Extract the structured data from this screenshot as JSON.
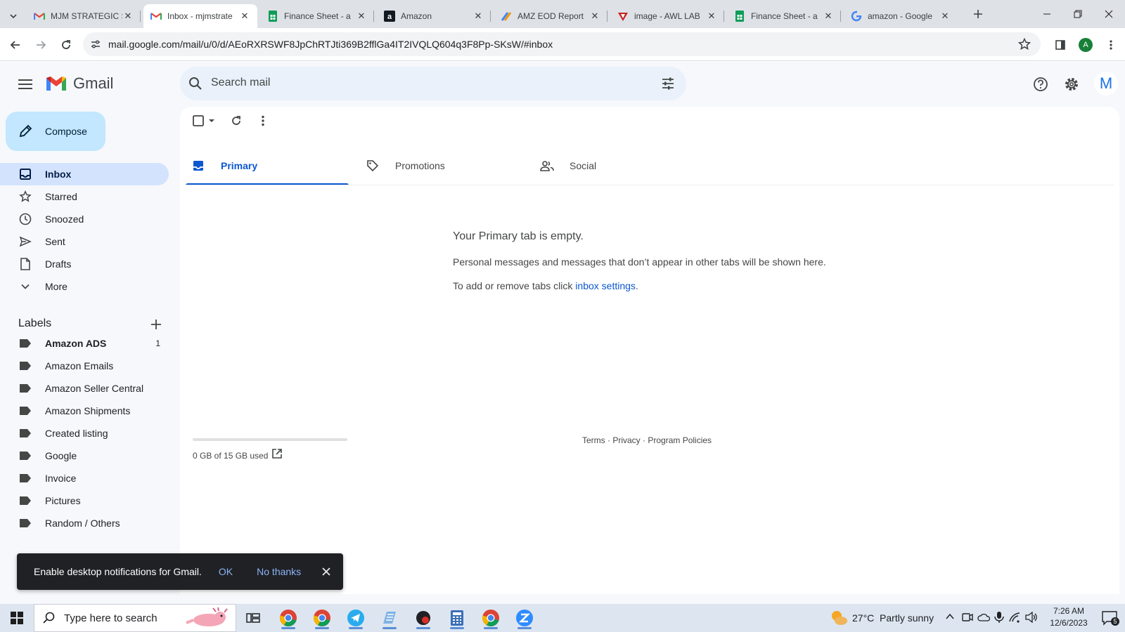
{
  "browser": {
    "tabs": [
      {
        "title": "MJM STRATEGIC S",
        "icon": "gmail-icon",
        "active": false
      },
      {
        "title": "Inbox - mjmstrate",
        "icon": "gmail-icon",
        "active": true
      },
      {
        "title": "Finance Sheet - a",
        "icon": "sheets-icon",
        "active": false
      },
      {
        "title": "Amazon",
        "icon": "amazon-icon",
        "active": false
      },
      {
        "title": "AMZ EOD Report",
        "icon": "report-icon",
        "active": false
      },
      {
        "title": "image - AWL LAB",
        "icon": "image-icon",
        "active": false
      },
      {
        "title": "Finance Sheet - a",
        "icon": "sheets-icon",
        "active": false
      },
      {
        "title": "amazon - Google",
        "icon": "google-icon",
        "active": false
      }
    ],
    "url": "mail.google.com/mail/u/0/d/AEoRXRSWF8JpChRTJti369B2fflGa4IT2IVQLQ604q3F8Pp-SKsW/#inbox",
    "profile_initial": "A"
  },
  "gmail": {
    "logo_text": "Gmail",
    "search_placeholder": "Search mail",
    "avatar_initial": "M",
    "compose_label": "Compose",
    "nav": [
      {
        "label": "Inbox",
        "icon": "inbox-icon",
        "active": true
      },
      {
        "label": "Starred",
        "icon": "star-icon",
        "active": false
      },
      {
        "label": "Snoozed",
        "icon": "clock-icon",
        "active": false
      },
      {
        "label": "Sent",
        "icon": "send-icon",
        "active": false
      },
      {
        "label": "Drafts",
        "icon": "draft-icon",
        "active": false
      },
      {
        "label": "More",
        "icon": "chevron-down-icon",
        "active": false
      }
    ],
    "labels_title": "Labels",
    "labels": [
      {
        "name": "Amazon ADS",
        "count": "1",
        "bold": true
      },
      {
        "name": "Amazon Emails",
        "count": "",
        "bold": false
      },
      {
        "name": "Amazon Seller Central",
        "count": "",
        "bold": false
      },
      {
        "name": "Amazon Shipments",
        "count": "",
        "bold": false
      },
      {
        "name": "Created listing",
        "count": "",
        "bold": false
      },
      {
        "name": "Google",
        "count": "",
        "bold": false
      },
      {
        "name": "Invoice",
        "count": "",
        "bold": false
      },
      {
        "name": "Pictures",
        "count": "",
        "bold": false
      },
      {
        "name": "Random / Others",
        "count": "",
        "bold": false
      }
    ],
    "inbox_tabs": [
      {
        "label": "Primary",
        "icon": "inbox-icon",
        "active": true
      },
      {
        "label": "Promotions",
        "icon": "tag-icon",
        "active": false
      },
      {
        "label": "Social",
        "icon": "people-icon",
        "active": false
      }
    ],
    "empty": {
      "title": "Your Primary tab is empty.",
      "subtitle": "Personal messages and messages that don’t appear in other tabs will be shown here.",
      "hint_prefix": "To add or remove tabs click ",
      "hint_link": "inbox settings",
      "hint_suffix": "."
    },
    "storage": {
      "text": "0 GB of 15 GB used",
      "fraction_used": 0.0
    },
    "footer": {
      "terms": "Terms",
      "sep": " · ",
      "privacy": "Privacy",
      "policies": "Program Policies"
    },
    "toast": {
      "message": "Enable desktop notifications for Gmail.",
      "ok": "OK",
      "no_thanks": "No thanks"
    }
  },
  "taskbar": {
    "search_placeholder": "Type here to search",
    "weather": "27°C  Partly sunny",
    "time": "7:26 AM",
    "date": "12/6/2023",
    "notification_count": "5"
  },
  "colors": {
    "accent": "#0b57d0",
    "compose_bg": "#c2e7ff",
    "active_nav_bg": "#d3e3fd",
    "app_bg": "#f6f8fc"
  }
}
